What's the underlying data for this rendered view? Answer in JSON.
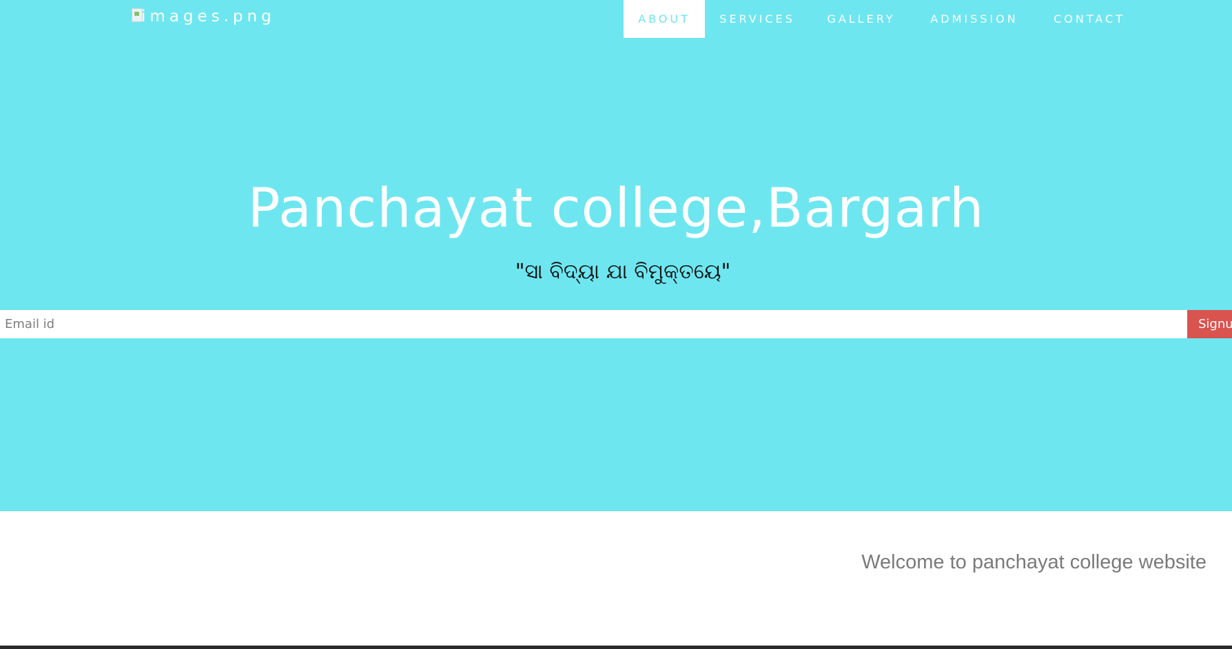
{
  "header": {
    "logo_alt": "images.png",
    "nav": {
      "about": "ABOUT",
      "services": "SERVICES",
      "gallery": "GALLERY",
      "admission": "ADMISSION",
      "contact": "CONTACT"
    }
  },
  "hero": {
    "title": "Panchayat college,Bargarh",
    "motto": "\"ସା ବିଦ୍ୟା ଯା ବିମୁକ୍ତୟେ\""
  },
  "signup": {
    "email_placeholder": "Email id",
    "button_label": "Signup"
  },
  "main": {
    "welcome": "Welcome to panchayat college website"
  },
  "colors": {
    "hero_bg": "#6ee6f0",
    "signup_button": "#d9534f",
    "active_nav_bg": "#ffffff"
  }
}
